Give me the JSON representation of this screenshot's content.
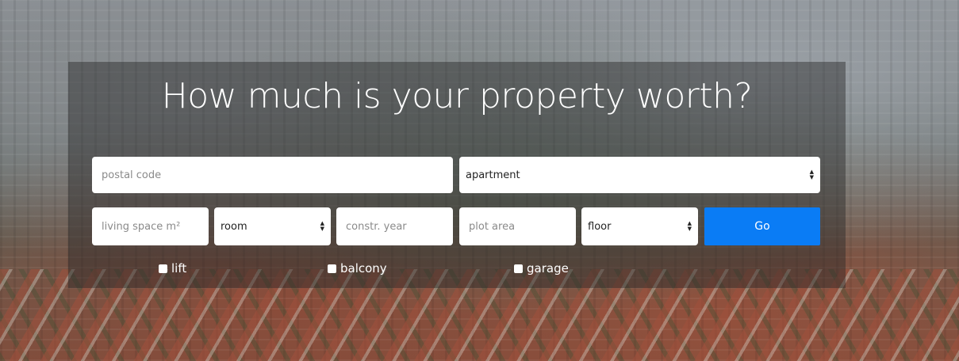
{
  "hero": {
    "title": "How much is your property worth?"
  },
  "form": {
    "postal_code_placeholder": "postal code",
    "property_type_selected": "apartment",
    "living_space_placeholder": "living space m²",
    "room_selected": "room",
    "construction_year_placeholder": "constr. year",
    "plot_area_placeholder": "plot area",
    "floor_selected": "floor",
    "go_label": "Go",
    "checkboxes": [
      {
        "label": "lift",
        "checked": false
      },
      {
        "label": "balcony",
        "checked": false
      },
      {
        "label": "garage",
        "checked": false
      }
    ]
  },
  "colors": {
    "accent": "#0a7cf5",
    "overlay": "rgba(40,40,40,0.45)"
  },
  "icons": {
    "select_arrows": "up-down-chevron-icon",
    "checkbox": "checkbox-icon"
  }
}
